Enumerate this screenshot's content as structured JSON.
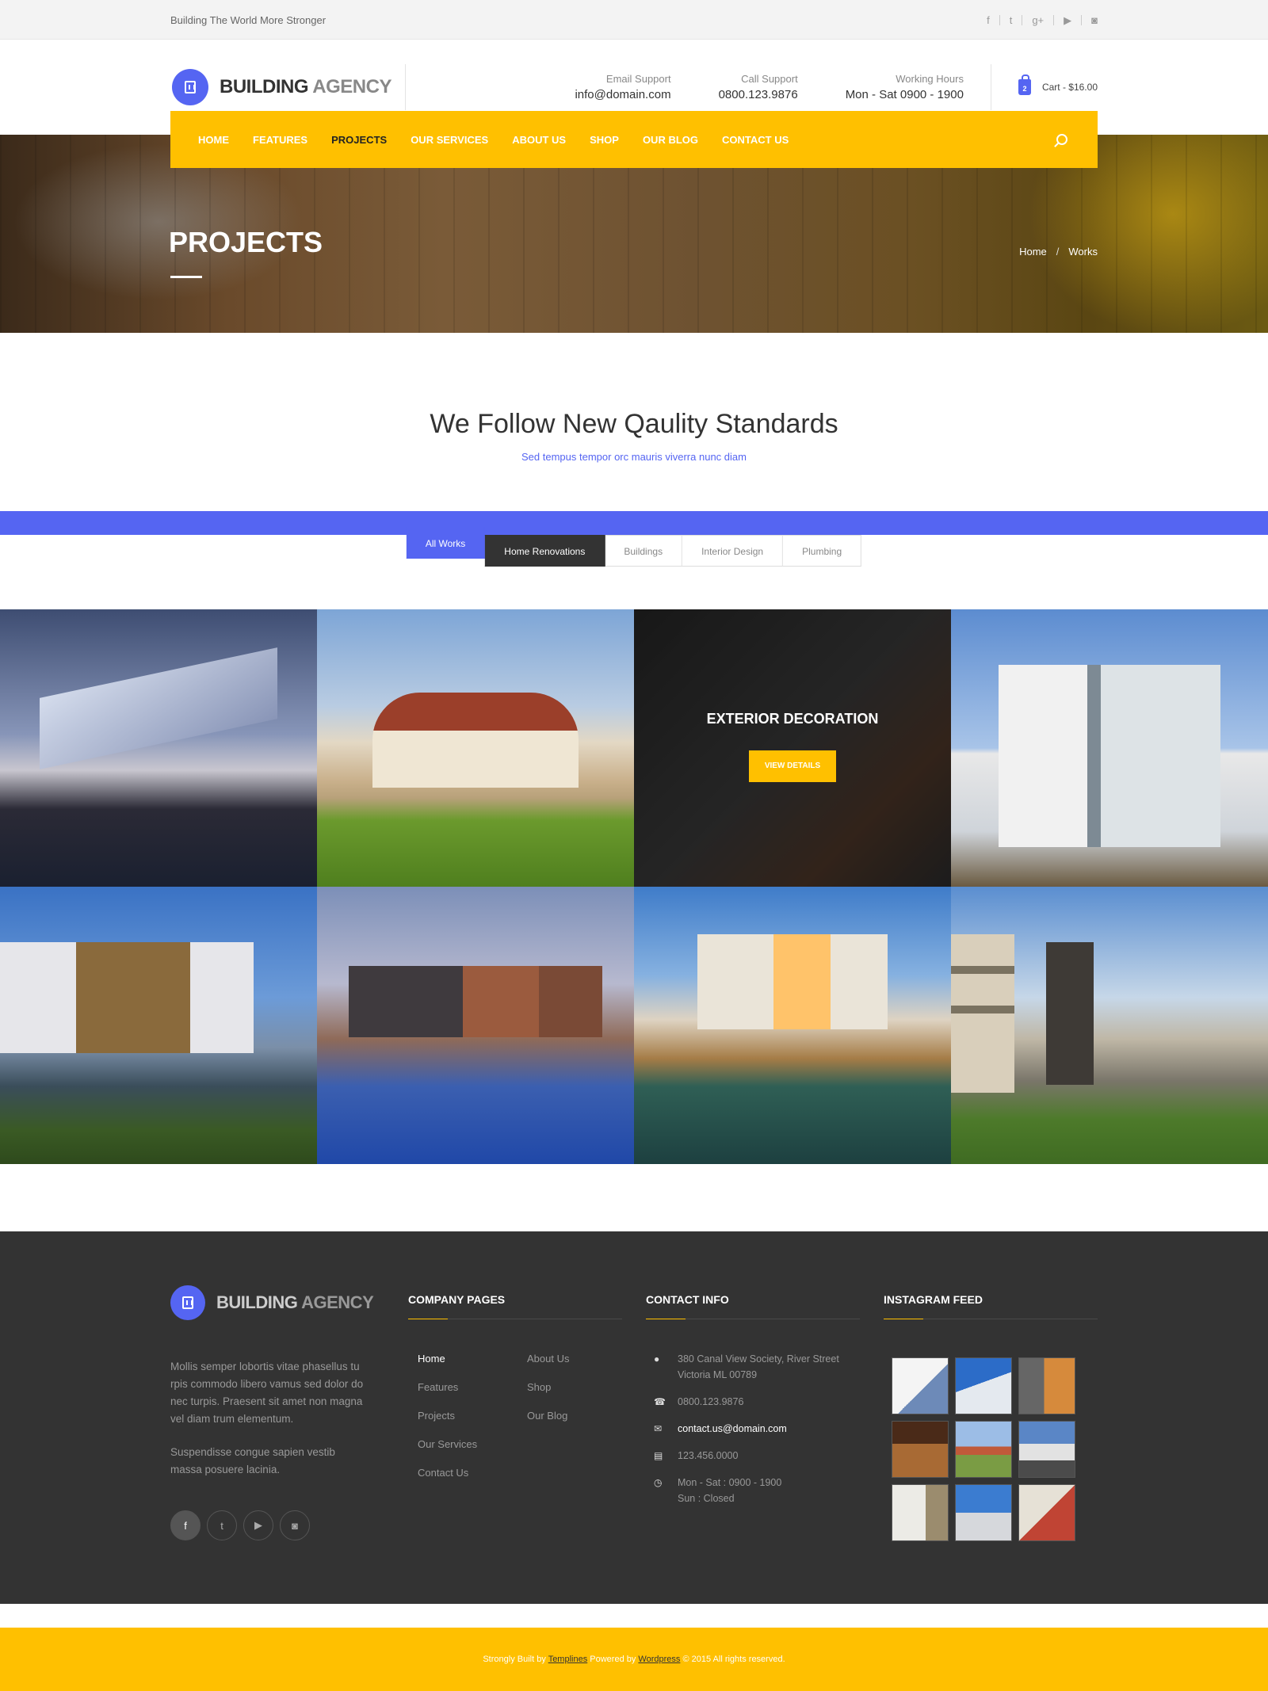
{
  "topbar": {
    "tagline": "Building The World More Stronger",
    "social_icons": [
      "facebook-icon",
      "twitter-icon",
      "google-plus-icon",
      "youtube-icon",
      "instagram-icon"
    ],
    "social_glyphs": [
      "f",
      "t",
      "g+",
      "▶",
      "◙"
    ]
  },
  "header": {
    "logo_bold": "BUILDING",
    "logo_light": " AGENCY",
    "email_label": "Email Support",
    "email_value": "info@domain.com",
    "call_label": "Call Support",
    "call_value": "0800.123.9876",
    "hours_label": "Working Hours",
    "hours_value": "Mon - Sat 0900 - 1900",
    "cart_count": "2",
    "cart_label": "Cart - $16.00"
  },
  "nav": {
    "items": [
      "HOME",
      "FEATURES",
      "PROJECTS",
      "OUR SERVICES",
      "ABOUT US",
      "SHOP",
      "OUR BLOG",
      "CONTACT US"
    ],
    "active": "PROJECTS"
  },
  "hero": {
    "title": "PROJECTS",
    "crumb_home": "Home",
    "crumb_sep": "/",
    "crumb_current": "Works"
  },
  "intro": {
    "heading": "We Follow New Qaulity Standards",
    "sub": "Sed tempus tempor orc mauris viverra nunc diam"
  },
  "filters": [
    "All Works",
    "Home Renovations",
    "Buildings",
    "Interior Design",
    "Plumbing"
  ],
  "gallery": {
    "overlay_title": "EXTERIOR DECORATION",
    "overlay_button": "VIEW DETAILS"
  },
  "footer": {
    "logo_bold": "BUILDING",
    "logo_light": " AGENCY",
    "desc1": "Mollis semper lobortis vitae phasellus tu rpis commodo libero vamus sed dolor do nec turpis. Praesent sit amet non magna vel diam trum elementum.",
    "desc2": "Suspendisse congue sapien vestib massa posuere lacinia.",
    "social_glyphs": [
      "f",
      "t",
      "▶",
      "◙"
    ],
    "company_heading": "COMPANY PAGES",
    "links": [
      "Home",
      "About Us",
      "Features",
      "Shop",
      "Projects",
      "Our Blog",
      "Our Services",
      "",
      "Contact Us"
    ],
    "contact_heading": "CONTACT INFO",
    "address_line1": "380 Canal View Society, River Street",
    "address_line2": "Victoria ML 00789",
    "phone": "0800.123.9876",
    "email": "contact.us@domain.com",
    "fax": "123.456.0000",
    "hours_line1": "Mon - Sat : 0900 - 1900",
    "hours_line2": "Sun : Closed",
    "instagram_heading": "INSTAGRAM FEED"
  },
  "bottom": {
    "part1": "Strongly Built by ",
    "templines": "Templines",
    "part2": " Powered by ",
    "wordpress": "Wordpress",
    "part3": "  © 2015 All rights reserved."
  },
  "colors": {
    "accent_blue": "#5565f2",
    "accent_yellow": "#ffc000",
    "footer_bg": "#333333"
  }
}
